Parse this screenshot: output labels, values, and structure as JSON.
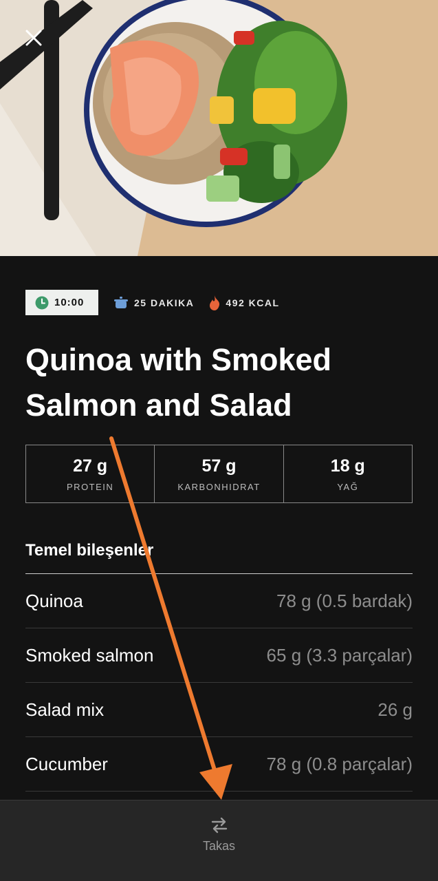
{
  "header": {
    "close_icon": "close-icon"
  },
  "meta": {
    "time": "10:00",
    "duration": "25 DAKIKA",
    "calories": "492 KCAL",
    "colors": {
      "clock": "#3d9a6a",
      "pot": "#6d9ed8",
      "flame": "#e8643a"
    }
  },
  "recipe": {
    "title": "Quinoa with Smoked Salmon and Salad"
  },
  "macros": [
    {
      "value": "27 g",
      "label": "PROTEIN"
    },
    {
      "value": "57 g",
      "label": "KARBONHIDRAT"
    },
    {
      "value": "18 g",
      "label": "YAĞ"
    }
  ],
  "ingredients": {
    "title": "Temel bileşenler",
    "items": [
      {
        "name": "Quinoa",
        "amount": "78 g (0.5 bardak)"
      },
      {
        "name": "Smoked salmon",
        "amount": "65 g (3.3 parçalar)"
      },
      {
        "name": "Salad mix",
        "amount": "26 g"
      },
      {
        "name": "Cucumber",
        "amount": "78 g (0.8 parçalar)"
      }
    ]
  },
  "bottom_bar": {
    "swap_label": "Takas",
    "swap_icon": "swap-arrows-icon"
  },
  "annotation": {
    "arrow_color": "#ee7a2f"
  }
}
